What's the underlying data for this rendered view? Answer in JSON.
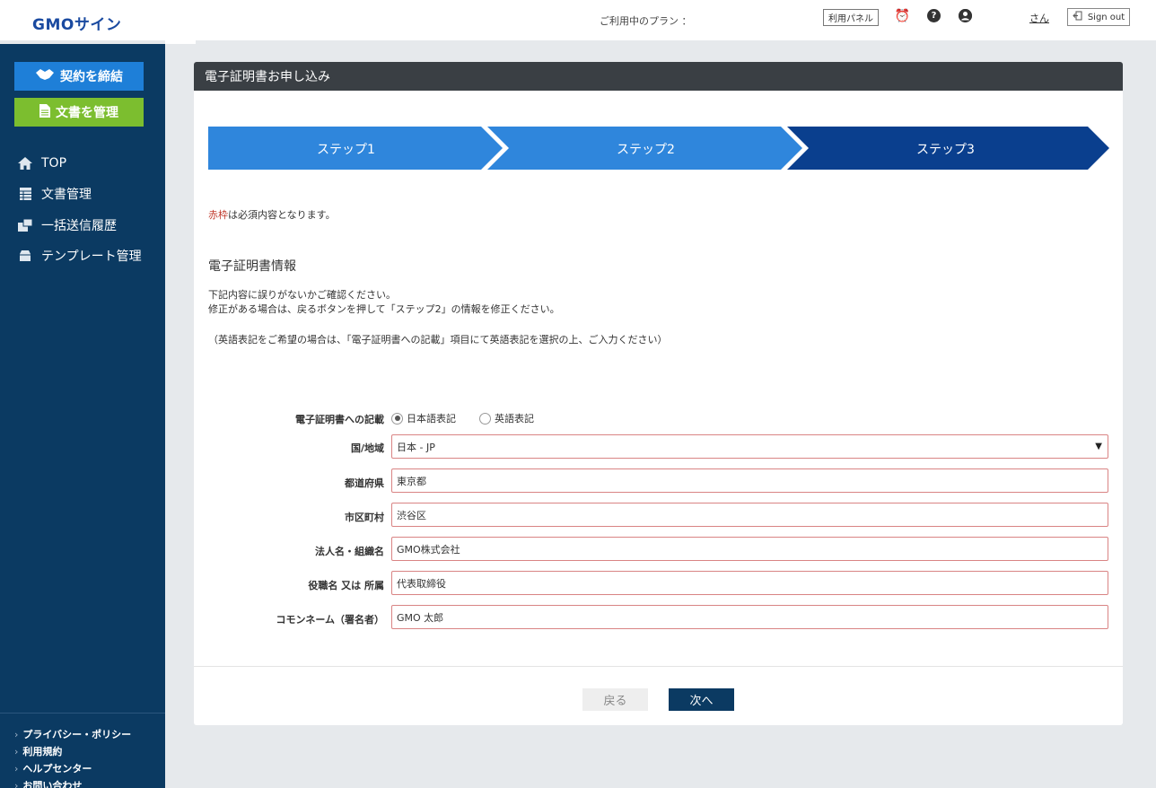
{
  "header": {
    "logo": "GMOサイン",
    "plan_label": "ご利用中のプラン ：",
    "panel_button": "利用パネル",
    "user_name": "さん",
    "sign_out": "Sign out"
  },
  "sidebar": {
    "contract_button": "契約を締結",
    "docs_button": "文書を管理",
    "nav": [
      {
        "label": "TOP",
        "icon": "home-icon"
      },
      {
        "label": "文書管理",
        "icon": "table-icon"
      },
      {
        "label": "一括送信履歴",
        "icon": "send-history-icon"
      },
      {
        "label": "テンプレート管理",
        "icon": "template-icon"
      }
    ],
    "footer_links": [
      "プライバシー・ポリシー",
      "利用規約",
      "ヘルプセンター",
      "お問い合わせ"
    ]
  },
  "main": {
    "title": "電子証明書お申し込み",
    "steps": [
      "ステップ1",
      "ステップ2",
      "ステップ3"
    ],
    "active_step": 3,
    "required_note_red": "赤枠",
    "required_note_rest": "は必須内容となります。",
    "section_title": "電子証明書情報",
    "description": [
      "下記内容に誤りがないかご確認ください。",
      "修正がある場合は、戻るボタンを押して「ステップ2」の情報を修正ください。",
      "（英語表記をご希望の場合は、「電子証明書への記載」項目にて英語表記を選択の上、ご入力ください）"
    ],
    "form": {
      "notation_label": "電子証明書への記載",
      "notation_options": [
        "日本語表記",
        "英語表記"
      ],
      "notation_selected": "日本語表記",
      "country_label": "国/地域",
      "country_value": "日本 - JP",
      "prefecture_label": "都道府県",
      "prefecture_value": "東京都",
      "city_label": "市区町村",
      "city_value": "渋谷区",
      "org_label": "法人名・組織名",
      "org_value": "GMO株式会社",
      "title_label": "役職名 又は 所属",
      "title_value": "代表取締役",
      "common_name_label": "コモンネーム（署名者）",
      "common_name_value": "GMO 太郎"
    },
    "back_button": "戻る",
    "next_button": "次へ"
  },
  "colors": {
    "sidebar_bg": "#0b3a62",
    "step_light": "#2f86dc",
    "step_active": "#0a3f8e",
    "contract_btn": "#1e7fd8",
    "docs_btn": "#7cbe2f",
    "required_border": "#d98484"
  }
}
